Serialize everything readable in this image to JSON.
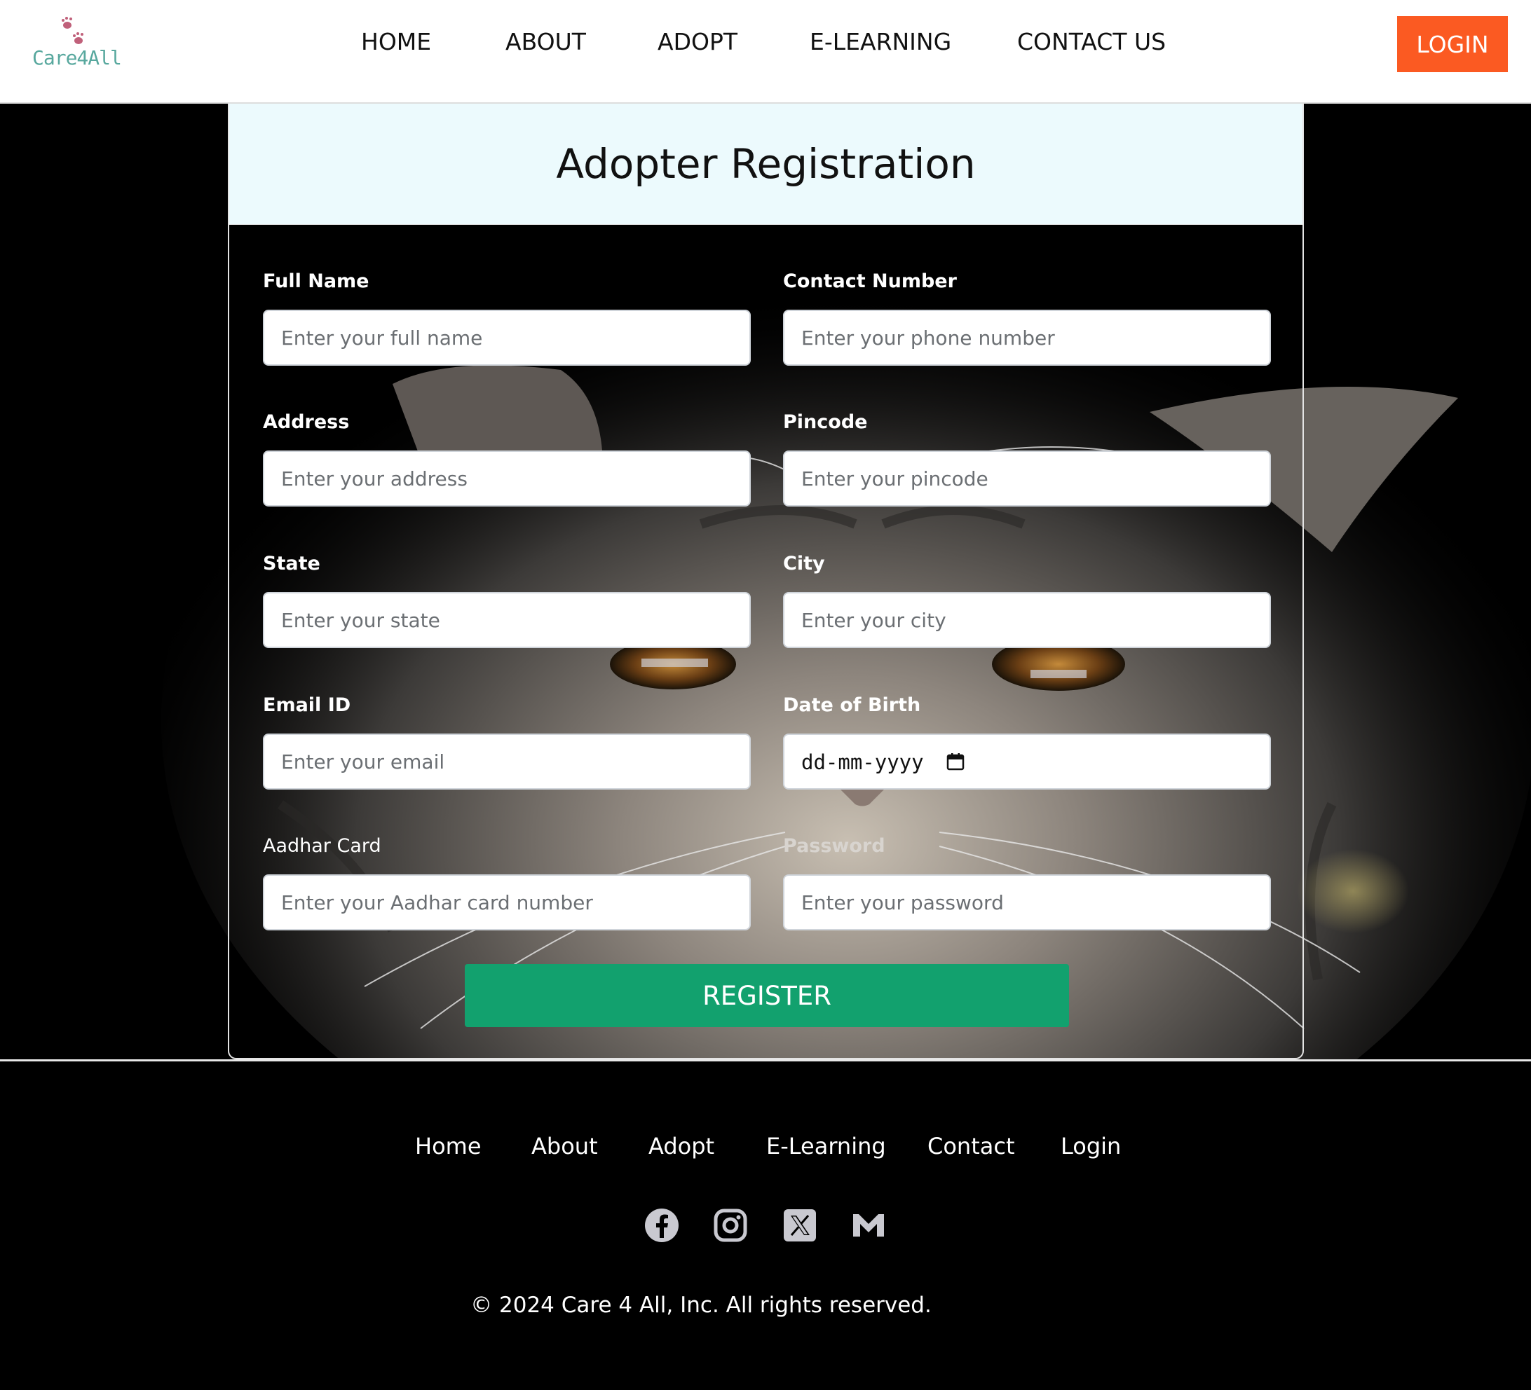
{
  "brand": {
    "name": "Care4All"
  },
  "nav": {
    "items": [
      "HOME",
      "ABOUT",
      "ADOPT",
      "E-LEARNING",
      "CONTACT US"
    ],
    "login_label": "LOGIN"
  },
  "form": {
    "title": "Adopter Registration",
    "fields": [
      {
        "label": "Full Name",
        "placeholder": "Enter your full name"
      },
      {
        "label": "Contact Number",
        "placeholder": "Enter your phone number"
      },
      {
        "label": "Address",
        "placeholder": "Enter your address"
      },
      {
        "label": "Pincode",
        "placeholder": "Enter your pincode"
      },
      {
        "label": "State",
        "placeholder": "Enter your state"
      },
      {
        "label": "City",
        "placeholder": "Enter your city"
      },
      {
        "label": "Email ID",
        "placeholder": "Enter your email"
      },
      {
        "label": "Date of Birth",
        "value": "dd-mm-yyyy"
      },
      {
        "label": "Aadhar Card",
        "placeholder": "Enter your Aadhar card number"
      },
      {
        "label": "Password",
        "placeholder": "Enter your password"
      }
    ],
    "submit_label": "REGISTER"
  },
  "footer": {
    "links": [
      "Home",
      "About",
      "Adopt",
      "E-Learning",
      "Contact",
      "Login"
    ],
    "social_icons": [
      "facebook-icon",
      "instagram-icon",
      "x-twitter-icon",
      "gmail-icon"
    ],
    "copyright": "© 2024 Care 4 All, Inc. All rights reserved."
  },
  "colors": {
    "login_button": "#fb5a22",
    "register_button": "#12a16e",
    "card_header": "#ecfafd",
    "logo_text": "#58a89e",
    "logo_paws": "#c0607a"
  }
}
